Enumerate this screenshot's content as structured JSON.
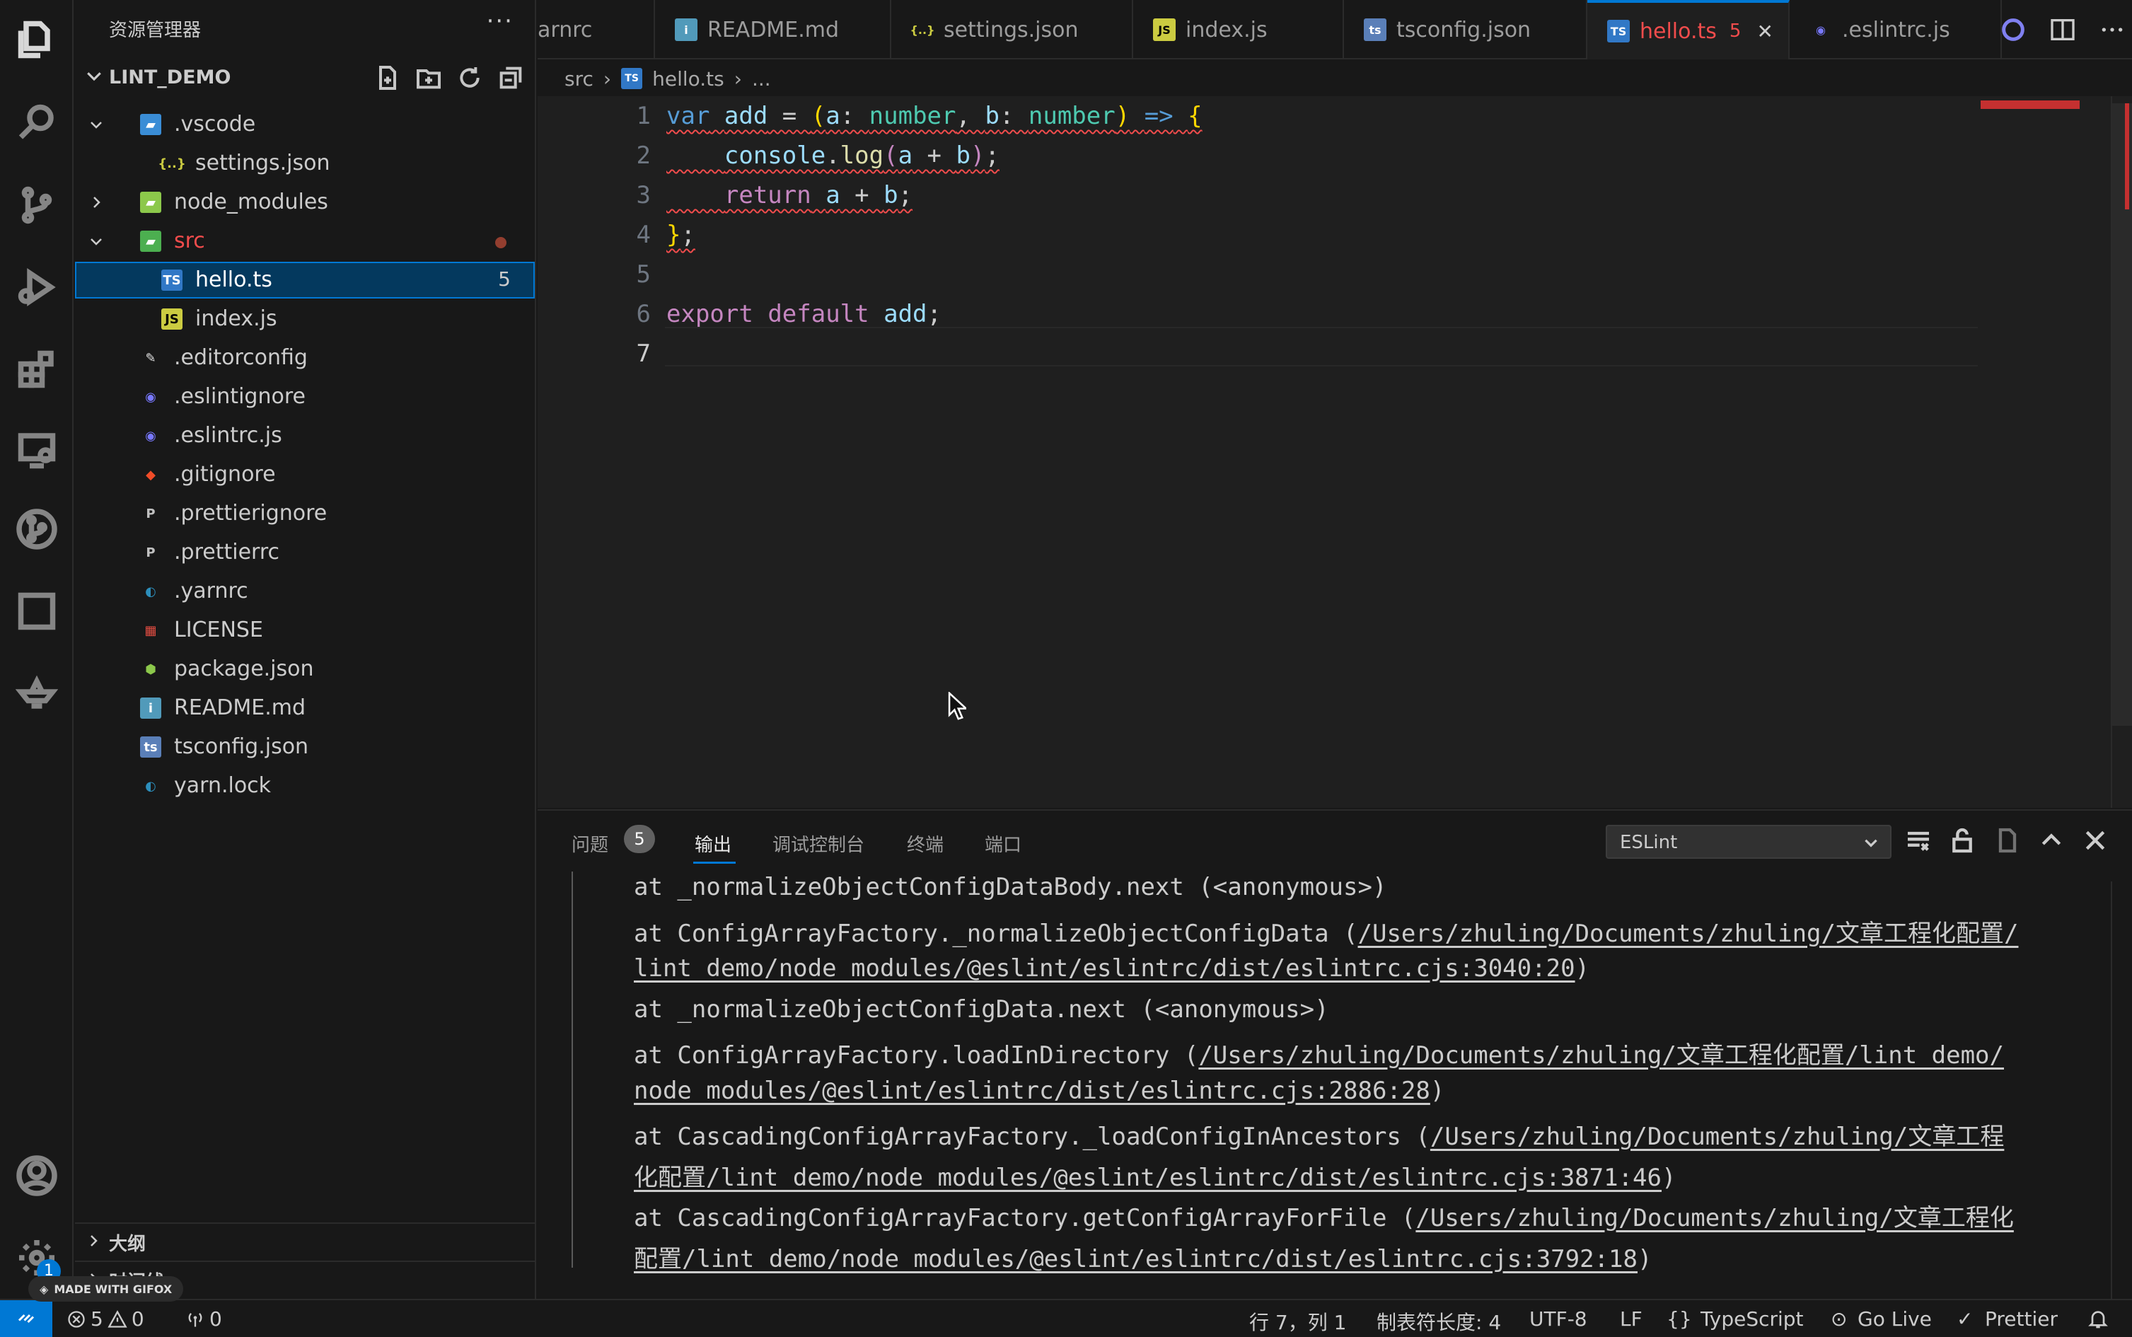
{
  "sidebar": {
    "title": "资源管理器",
    "more": "···",
    "project": "LINT_DEMO",
    "tree": [
      {
        "label": ".vscode",
        "icon": "folder-vscode-icon",
        "depth": 1,
        "chev": "down"
      },
      {
        "label": "settings.json",
        "icon": "json-icon",
        "depth": 2
      },
      {
        "label": "node_modules",
        "icon": "folder-node-icon",
        "depth": 1,
        "chev": "right"
      },
      {
        "label": "src",
        "icon": "folder-src-icon",
        "depth": 1,
        "chev": "down",
        "dot": true
      },
      {
        "label": "hello.ts",
        "icon": "typescript-icon",
        "depth": 2,
        "badge": "5",
        "selected": true
      },
      {
        "label": "index.js",
        "icon": "javascript-icon",
        "depth": 2
      },
      {
        "label": ".editorconfig",
        "icon": "editorconfig-icon",
        "depth": 1
      },
      {
        "label": ".eslintignore",
        "icon": "eslint-icon",
        "depth": 1
      },
      {
        "label": ".eslintrc.js",
        "icon": "eslint-icon",
        "depth": 1
      },
      {
        "label": ".gitignore",
        "icon": "git-icon",
        "depth": 1
      },
      {
        "label": ".prettierignore",
        "icon": "prettier-icon",
        "depth": 1
      },
      {
        "label": ".prettierrc",
        "icon": "prettier-icon",
        "depth": 1
      },
      {
        "label": ".yarnrc",
        "icon": "yarn-icon",
        "depth": 1
      },
      {
        "label": "LICENSE",
        "icon": "license-icon",
        "depth": 1
      },
      {
        "label": "package.json",
        "icon": "nodejs-icon",
        "depth": 1
      },
      {
        "label": "README.md",
        "icon": "info-icon",
        "depth": 1
      },
      {
        "label": "tsconfig.json",
        "icon": "tsconfig-icon",
        "depth": 1
      },
      {
        "label": "yarn.lock",
        "icon": "yarn-icon",
        "depth": 1
      }
    ],
    "outline": "大纲",
    "timeline": "时间线"
  },
  "tabs": [
    {
      "label": "arnrc",
      "icon": ""
    },
    {
      "label": "README.md",
      "icon": "info-icon"
    },
    {
      "label": "settings.json",
      "icon": "json-icon"
    },
    {
      "label": "index.js",
      "icon": "javascript-icon"
    },
    {
      "label": "tsconfig.json",
      "icon": "tsconfig-icon"
    },
    {
      "label": "hello.ts",
      "icon": "typescript-icon",
      "badge": "5",
      "active": true
    },
    {
      "label": ".eslintrc.js",
      "icon": "eslint-icon"
    }
  ],
  "breadcrumb": [
    "src",
    "hello.ts",
    "..."
  ],
  "editor": {
    "line_numbers": [
      "1",
      "2",
      "3",
      "4",
      "5",
      "6",
      "7"
    ],
    "current_line": "7"
  },
  "panel": {
    "tabs": {
      "problems": "问题",
      "problems_count": "5",
      "output": "输出",
      "debug_console": "调试控制台",
      "terminal": "终端",
      "ports": "端口"
    },
    "channel": "ESLint",
    "output_lines": [
      {
        "text": "at _normalizeObjectConfigDataBody.next (<anonymous>)"
      },
      {
        "text": "at ConfigArrayFactory._normalizeObjectConfigData (",
        "link": "/Users/zhuling/Documents/zhuling/文章工程化配置/"
      },
      {
        "link": "lint_demo/node_modules/@eslint/eslintrc/dist/eslintrc.cjs:3040:20",
        "after": ")"
      },
      {
        "text": "at _normalizeObjectConfigData.next (<anonymous>)"
      },
      {
        "text": "at ConfigArrayFactory.loadInDirectory (",
        "link": "/Users/zhuling/Documents/zhuling/文章工程化配置/lint_demo/"
      },
      {
        "link": "node_modules/@eslint/eslintrc/dist/eslintrc.cjs:2886:28",
        "after": ")"
      },
      {
        "text": "at CascadingConfigArrayFactory._loadConfigInAncestors (",
        "link": "/Users/zhuling/Documents/zhuling/文章工程"
      },
      {
        "link": "化配置/lint_demo/node_modules/@eslint/eslintrc/dist/eslintrc.cjs:3871:46",
        "after": ")"
      },
      {
        "text": "at CascadingConfigArrayFactory.getConfigArrayForFile (",
        "link": "/Users/zhuling/Documents/zhuling/文章工程化"
      },
      {
        "link": "配置/lint_demo/node_modules/@eslint/eslintrc/dist/eslintrc.cjs:3792:18",
        "after": ")"
      }
    ]
  },
  "status": {
    "errors": "5",
    "warnings": "0",
    "ports": "0",
    "position": "行 7，列 1",
    "tab_size": "制表符长度: 4",
    "encoding": "UTF-8",
    "eol": "LF",
    "language": "TypeScript",
    "golive": "Go Live",
    "prettier": "Prettier",
    "settings_badge": "1"
  },
  "gifox": "MADE WITH GIFOX",
  "colors": {
    "accent": "#0078d4",
    "error": "#f14c4c",
    "selection": "#04395e"
  }
}
